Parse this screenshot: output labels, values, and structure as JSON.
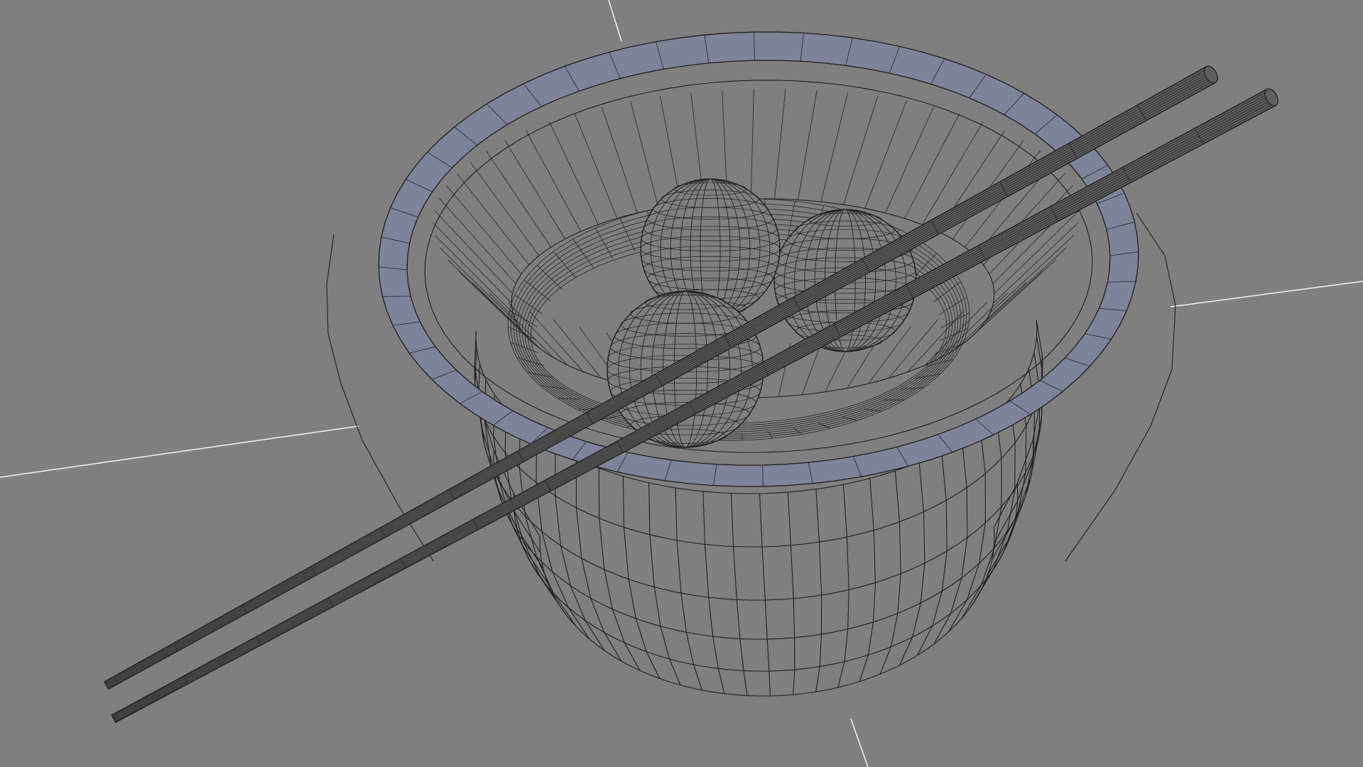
{
  "viewport": {
    "background_color": "#7f7f7f",
    "wire_color": "#1f1f1f",
    "axis_color": "#f2f2f2",
    "rim_shade_color": "#7d8399",
    "shading_mode": "wireframe"
  },
  "scene": {
    "objects": [
      "bowl",
      "bowl-rim",
      "dish",
      "bun",
      "bun",
      "bun",
      "chopstick",
      "chopstick"
    ],
    "bun_count": 3,
    "chopstick_count": 2
  }
}
